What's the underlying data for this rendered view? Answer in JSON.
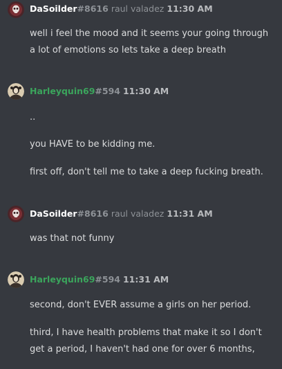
{
  "messages": [
    {
      "username": "DaSoilder",
      "tag": "#8616",
      "nickname": "raul valadez",
      "time": "11:30 AM",
      "lines": [
        "well i feel the mood and it seems your going through",
        "a lot of emotions so lets take a deep breath"
      ]
    },
    {
      "username": "Harleyquin69",
      "tag": "#594",
      "time": "11:30 AM",
      "lines": [
        "..",
        "you HAVE to be kidding me.",
        "first off, don't tell me to take a deep fucking breath."
      ]
    },
    {
      "username": "DaSoilder",
      "tag": "#8616",
      "nickname": "raul valadez",
      "time": "11:31 AM",
      "lines": [
        "was that not funny"
      ]
    },
    {
      "username": "Harleyquin69",
      "tag": "#594",
      "time": "11:31 AM",
      "lines": [
        "second, don't EVER assume a girls on her period.",
        "third, I have health problems that make it so I don't",
        "get a period, I haven't had one for over 6 months,"
      ]
    }
  ],
  "colors": {
    "background": "#36393f",
    "username_default": "#ffffff",
    "username_harley": "#3ba55c",
    "tag": "#8e9297",
    "message_text": "#dcddde"
  },
  "icons": {
    "dasoilder_avatar": "skull-avatar-icon",
    "harley_avatar": "harley-avatar-icon"
  }
}
